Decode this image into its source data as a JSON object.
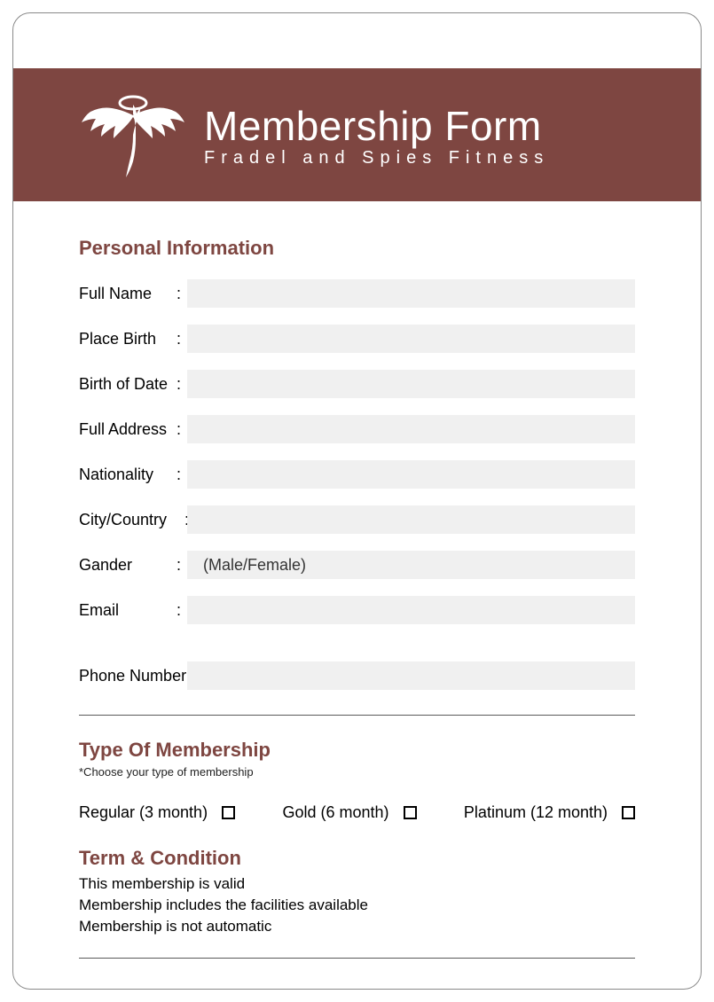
{
  "header": {
    "title": "Membership Form",
    "subtitle": "Fradel and Spies Fitness"
  },
  "sections": {
    "personal": {
      "heading": "Personal Information",
      "fields": {
        "full_name": {
          "label": "Full Name",
          "value": ""
        },
        "place_birth": {
          "label": "Place Birth",
          "value": ""
        },
        "birth_date": {
          "label": "Birth of Date",
          "value": ""
        },
        "full_address": {
          "label": "Full Address",
          "value": ""
        },
        "nationality": {
          "label": "Nationality",
          "value": ""
        },
        "city_country": {
          "label": "City/Country",
          "value": ""
        },
        "gender": {
          "label": "Gander",
          "value": "(Male/Female)"
        },
        "email": {
          "label": "Email",
          "value": ""
        },
        "phone": {
          "label": "Phone Number",
          "value": ""
        }
      }
    },
    "membership": {
      "heading": "Type Of Membership",
      "note": "*Choose your type of membership",
      "options": {
        "regular": "Regular (3 month)",
        "gold": "Gold (6 month)",
        "platinum": "Platinum (12 month)"
      }
    },
    "terms": {
      "heading": "Term & Condition",
      "lines": {
        "l1": "This membership is valid",
        "l2": "Membership includes the facilities available",
        "l3": "Membership is not automatic"
      }
    }
  }
}
